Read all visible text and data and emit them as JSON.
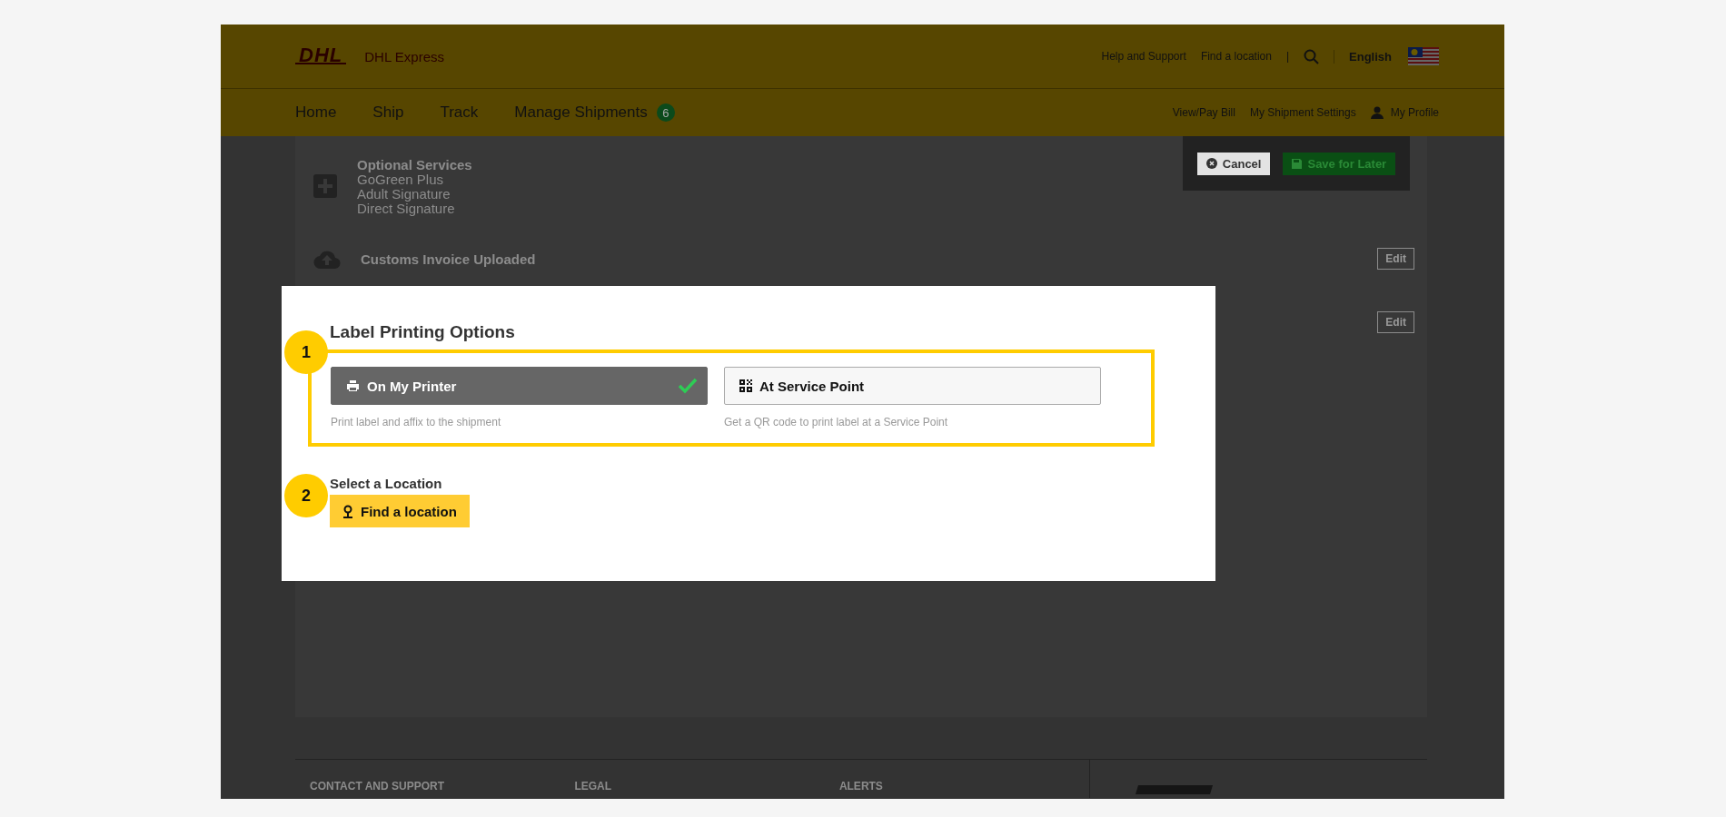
{
  "header": {
    "logo": "DHL",
    "brand": "DHL Express",
    "utility_links": [
      "Help and Support",
      "Find a location"
    ],
    "separator": "|",
    "language": "English"
  },
  "nav": {
    "items": [
      {
        "label": "Home"
      },
      {
        "label": "Ship"
      },
      {
        "label": "Track"
      },
      {
        "label": "Manage Shipments",
        "badge": "6"
      }
    ],
    "right_links": [
      "View/Pay Bill",
      "My Shipment Settings"
    ],
    "profile": "My Profile"
  },
  "action_bar": {
    "cancel": "Cancel",
    "save": "Save for Later"
  },
  "sections": [
    {
      "kind": "add",
      "title": "Optional Services",
      "lines": [
        "GoGreen Plus",
        "Adult Signature",
        "Direct Signature"
      ]
    },
    {
      "kind": "upload",
      "title": "Customs Invoice Uploaded",
      "action": "Edit"
    },
    {
      "kind": "blank",
      "action": "Edit"
    }
  ],
  "modal": {
    "title": "Label Printing Options",
    "steps": [
      "1",
      "2"
    ],
    "options": [
      {
        "kind": "printer",
        "label": "On My Printer",
        "description": "Print label and affix to the shipment",
        "selected": true
      },
      {
        "kind": "qr",
        "label": "At Service Point",
        "description": "Get a QR code to print label at a Service Point",
        "selected": false
      }
    ],
    "location_label": "Select a Location",
    "location_button": "Find a location"
  },
  "footer": {
    "headings": [
      "CONTACT AND SUPPORT",
      "LEGAL",
      "ALERTS"
    ]
  }
}
